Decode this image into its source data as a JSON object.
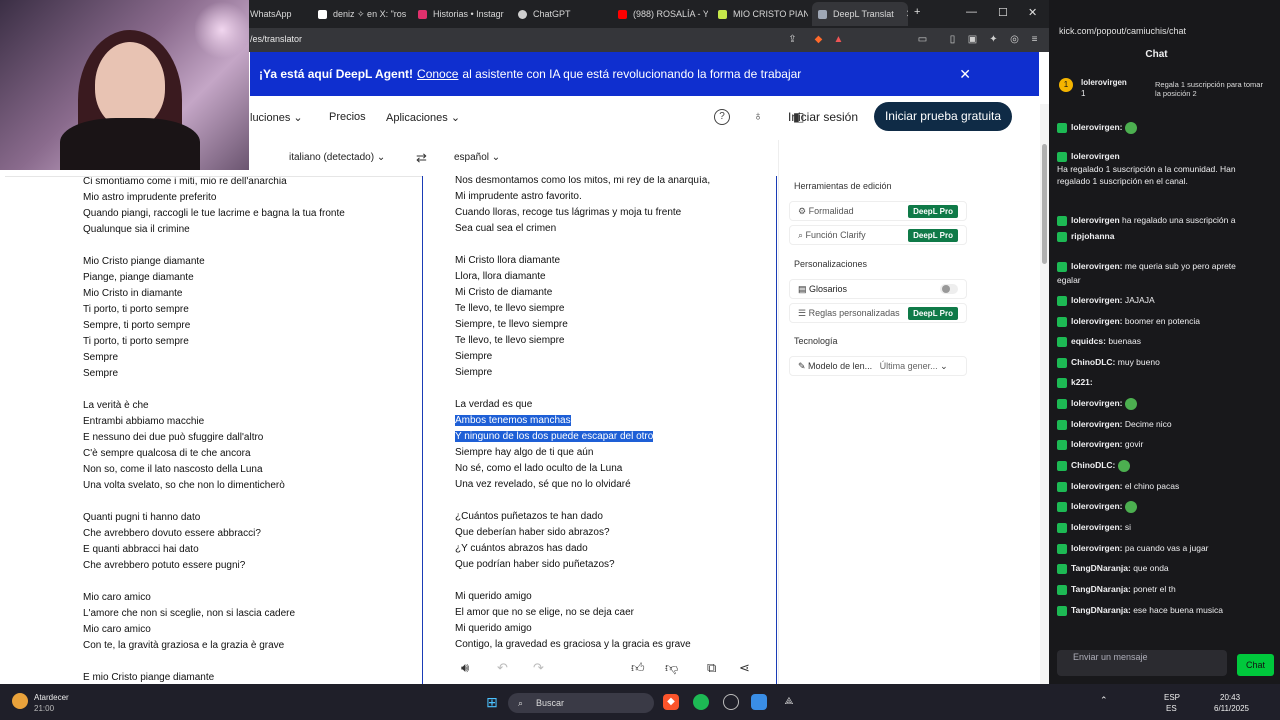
{
  "browser": {
    "tabs": [
      {
        "label": "WhatsApp",
        "color": "#25d366"
      },
      {
        "label": "deniz ✧ en X: \"ros",
        "color": "#ffffff"
      },
      {
        "label": "Historias • Instagr",
        "color": "#e1306c"
      },
      {
        "label": "ChatGPT",
        "color": "#cfcfcf"
      },
      {
        "label": "(988) ROSALÍA - Ye",
        "color": "#ff0000"
      },
      {
        "label": "MIO CRISTO PIAN",
        "color": "#c6e84a"
      },
      {
        "label": "DeepL Translat",
        "color": "#9ea7b5",
        "active": true
      }
    ],
    "url": "/es/translator"
  },
  "banner": {
    "bold": "¡Ya está aquí DeepL Agent!",
    "link": "Conoce",
    "text": "al asistente con IA que está revolucionando la forma de trabajar"
  },
  "nav": {
    "items": [
      "luciones",
      "Precios",
      "Aplicaciones"
    ],
    "login": "Iniciar sesión",
    "cta": "Iniciar prueba gratuita"
  },
  "langs": {
    "source": "italiano (detectado)",
    "target": "español"
  },
  "source_lines": [
    "Ci smontiamo come i miti, mio re dell'anarchia",
    "Mio astro imprudente preferito",
    "Quando piangi, raccogli le tue lacrime e bagna la tua fronte",
    "Qualunque sia il crimine",
    "",
    "Mio Cristo piange diamante",
    "Piange, piange diamante",
    "Mio Cristo in diamante",
    "Ti porto, ti porto sempre",
    "Sempre, ti porto sempre",
    "Ti porto, ti porto sempre",
    "Sempre",
    "Sempre",
    "",
    "La verità è che",
    "Entrambi abbiamo macchie",
    "E nessuno dei due può sfuggire dall'altro",
    "C'è sempre qualcosa di te che ancora",
    "Non so, come il lato nascosto della Luna",
    "Una volta svelato, so che non lo dimenticherò",
    "",
    "Quanti pugni ti hanno dato",
    "Che avrebbero dovuto essere abbracci?",
    "E quanti abbracci hai dato",
    "Che avrebbero potuto essere pugni?",
    "",
    "Mio caro amico",
    "L'amore che non si sceglie, non si lascia cadere",
    "Mio caro amico",
    "Con te, la gravità graziosa e la grazia è grave",
    "",
    "E mio Cristo piange diamante"
  ],
  "target_lines": [
    "Nos desmontamos como los mitos, mi rey de la anarquía,",
    "Mi imprudente astro favorito.",
    "Cuando lloras, recoge tus lágrimas y moja tu frente",
    "Sea cual sea el crimen",
    "",
    "Mi Cristo llora diamante",
    "Llora, llora diamante",
    "Mi Cristo de diamante",
    "Te llevo, te llevo siempre",
    "Siempre, te llevo siempre",
    "Te llevo, te llevo siempre",
    "Siempre",
    "Siempre",
    "",
    "La verdad es que",
    "Ambos tenemos manchas",
    "Y ninguno de los dos puede escapar del otro",
    "Siempre hay algo de ti que aún",
    "No sé, como el lado oculto de la Luna",
    "Una vez revelado, sé que no lo olvidaré",
    "",
    "¿Cuántos puñetazos te han dado",
    "Que deberían haber sido abrazos?",
    "¿Y cuántos abrazos has dado",
    "Que podrían haber sido puñetazos?",
    "",
    "Mi querido amigo",
    "El amor que no se elige, no se deja caer",
    "Mi querido amigo",
    "Contigo, la gravedad es graciosa y la gracia es grave"
  ],
  "sidepanel": {
    "edit_title": "Herramientas de edición",
    "formality": "Formalidad",
    "clarify": "Función Clarify",
    "pro": "DeepL Pro",
    "custom_title": "Personalizaciones",
    "glossaries": "Glosarios",
    "rules": "Reglas personalizadas",
    "tech_title": "Tecnología",
    "model": "Modelo de len...",
    "model_value": "Última gener..."
  },
  "chat": {
    "url": "kick.com/popout/camiuchis/chat",
    "title": "Chat",
    "pinned_user": "lolerovirgen",
    "pinned_count": "1",
    "pinned_text": "Regala 1 suscripción para tomar la posición 2",
    "messages": [
      {
        "user": "lolerovirgen:",
        "text": "",
        "emote": true
      },
      {
        "user": "lolerovirgen",
        "text": "",
        "emote": false
      },
      {
        "user": "",
        "text": "Ha regalado 1 suscripción a la comunidad. Han",
        "emote": false
      },
      {
        "user": "",
        "text": "regalado 1 suscripción en el canal.",
        "emote": false
      },
      {
        "user": "lolerovirgen",
        "text": "ha regalado una suscripción a",
        "emote": false
      },
      {
        "user": "ripjohanna",
        "text": "",
        "emote": false
      },
      {
        "user": "lolerovirgen:",
        "text": "me queria sub yo pero aprete",
        "emote": false
      },
      {
        "user": "",
        "text": "egalar",
        "emote": false
      },
      {
        "user": "lolerovirgen:",
        "text": "JAJAJA",
        "emote": false
      },
      {
        "user": "lolerovirgen:",
        "text": "boomer en potencia",
        "emote": false
      },
      {
        "user": "equidcs:",
        "text": "buenaas",
        "emote": false
      },
      {
        "user": "ChinoDLC:",
        "text": "muy bueno",
        "emote": false
      },
      {
        "user": "k221:",
        "text": "",
        "emote": false
      },
      {
        "user": "lolerovirgen:",
        "text": "",
        "emote": true
      },
      {
        "user": "lolerovirgen:",
        "text": "Decime nico",
        "emote": false
      },
      {
        "user": "lolerovirgen:",
        "text": "govir",
        "emote": false
      },
      {
        "user": "ChinoDLC:",
        "text": "",
        "emote": true
      },
      {
        "user": "lolerovirgen:",
        "text": "el chino pacas",
        "emote": false
      },
      {
        "user": "lolerovirgen:",
        "text": "",
        "emote": true
      },
      {
        "user": "lolerovirgen:",
        "text": "si",
        "emote": false
      },
      {
        "user": "lolerovirgen:",
        "text": "pa cuando vas a jugar",
        "emote": false
      },
      {
        "user": "TangDNaranja:",
        "text": "que onda",
        "emote": false
      },
      {
        "user": "TangDNaranja:",
        "text": "ponetr el th",
        "emote": false
      },
      {
        "user": "TangDNaranja:",
        "text": "ese hace buena musica",
        "emote": false
      }
    ],
    "input_placeholder": "Enviar un mensaje",
    "send": "Chat"
  },
  "taskbar": {
    "weather": "Atardecer",
    "weather_time": "21:00",
    "search": "Buscar",
    "lang1": "ESP",
    "lang2": "ES",
    "time": "20:43",
    "date": "6/11/2025"
  }
}
